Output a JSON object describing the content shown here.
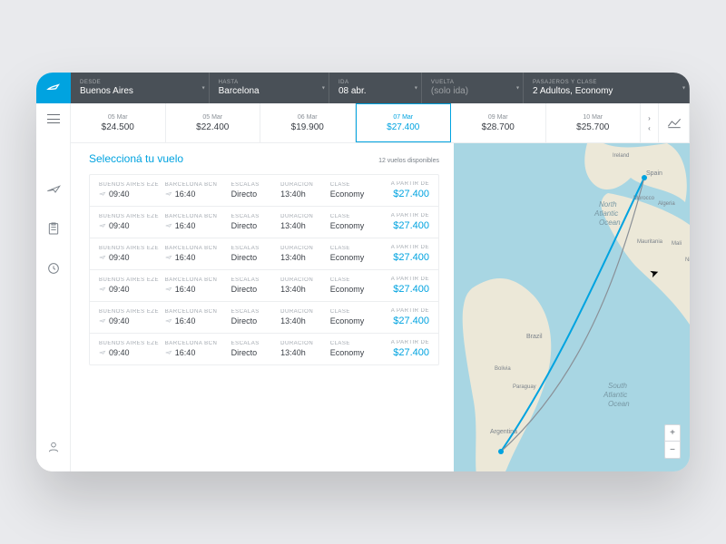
{
  "brand": {
    "name": "airline-logo"
  },
  "search": {
    "from": {
      "label": "Desde",
      "value": "Buenos Aires"
    },
    "to": {
      "label": "Hasta",
      "value": "Barcelona"
    },
    "go": {
      "label": "Ida",
      "value": "08 abr."
    },
    "back": {
      "label": "Vuelta",
      "value": "(solo ida)"
    },
    "pax": {
      "label": "Pasajeros y clase",
      "value": "2 Adultos, Economy"
    }
  },
  "carousel": {
    "items": [
      {
        "date": "05 Mar",
        "price": "$24.500",
        "active": false
      },
      {
        "date": "05 Mar",
        "price": "$22.400",
        "active": false
      },
      {
        "date": "06 Mar",
        "price": "$19.900",
        "active": false
      },
      {
        "date": "07 Mar",
        "price": "$27.400",
        "active": true
      },
      {
        "date": "09 Mar",
        "price": "$28.700",
        "active": false
      },
      {
        "date": "10 Mar",
        "price": "$25.700",
        "active": false
      }
    ]
  },
  "list": {
    "title": "Seleccioná tu vuelo",
    "count": "12 vuelos disponibles",
    "headers": {
      "escalas": "Escalas",
      "duracion": "Duración",
      "clase": "Clase",
      "apartir": "A partir de"
    },
    "flights": [
      {
        "depCity": "Buenos Aires",
        "depCode": "EZE",
        "depTime": "09:40",
        "arrCity": "Barcelona",
        "arrCode": "BCN",
        "arrTime": "16:40",
        "stops": "Directo",
        "duration": "13:40h",
        "class": "Economy",
        "price": "$27.400"
      },
      {
        "depCity": "Buenos Aires",
        "depCode": "EZE",
        "depTime": "09:40",
        "arrCity": "Barcelona",
        "arrCode": "BCN",
        "arrTime": "16:40",
        "stops": "Directo",
        "duration": "13:40h",
        "class": "Economy",
        "price": "$27.400"
      },
      {
        "depCity": "Buenos Aires",
        "depCode": "EZE",
        "depTime": "09:40",
        "arrCity": "Barcelona",
        "arrCode": "BCN",
        "arrTime": "16:40",
        "stops": "Directo",
        "duration": "13:40h",
        "class": "Economy",
        "price": "$27.400"
      },
      {
        "depCity": "Buenos Aires",
        "depCode": "EZE",
        "depTime": "09:40",
        "arrCity": "Barcelona",
        "arrCode": "BCN",
        "arrTime": "16:40",
        "stops": "Directo",
        "duration": "13:40h",
        "class": "Economy",
        "price": "$27.400"
      },
      {
        "depCity": "Buenos Aires",
        "depCode": "EZE",
        "depTime": "09:40",
        "arrCity": "Barcelona",
        "arrCode": "BCN",
        "arrTime": "16:40",
        "stops": "Directo",
        "duration": "13:40h",
        "class": "Economy",
        "price": "$27.400"
      },
      {
        "depCity": "Buenos Aires",
        "depCode": "EZE",
        "depTime": "09:40",
        "arrCity": "Barcelona",
        "arrCode": "BCN",
        "arrTime": "16:40",
        "stops": "Directo",
        "duration": "13:40h",
        "class": "Economy",
        "price": "$27.400"
      }
    ]
  },
  "map": {
    "labels": {
      "nAtlantic": "North Atlantic Ocean",
      "sAtlantic": "South Atlantic Ocean",
      "countries": [
        "Spain",
        "Morocco",
        "Algeria",
        "Mauritania",
        "Mali",
        "Ni",
        "Brazil",
        "Bolivia",
        "Paraguay",
        "Argentina",
        "Ireland"
      ]
    },
    "zoom": {
      "in": "+",
      "out": "−"
    }
  }
}
